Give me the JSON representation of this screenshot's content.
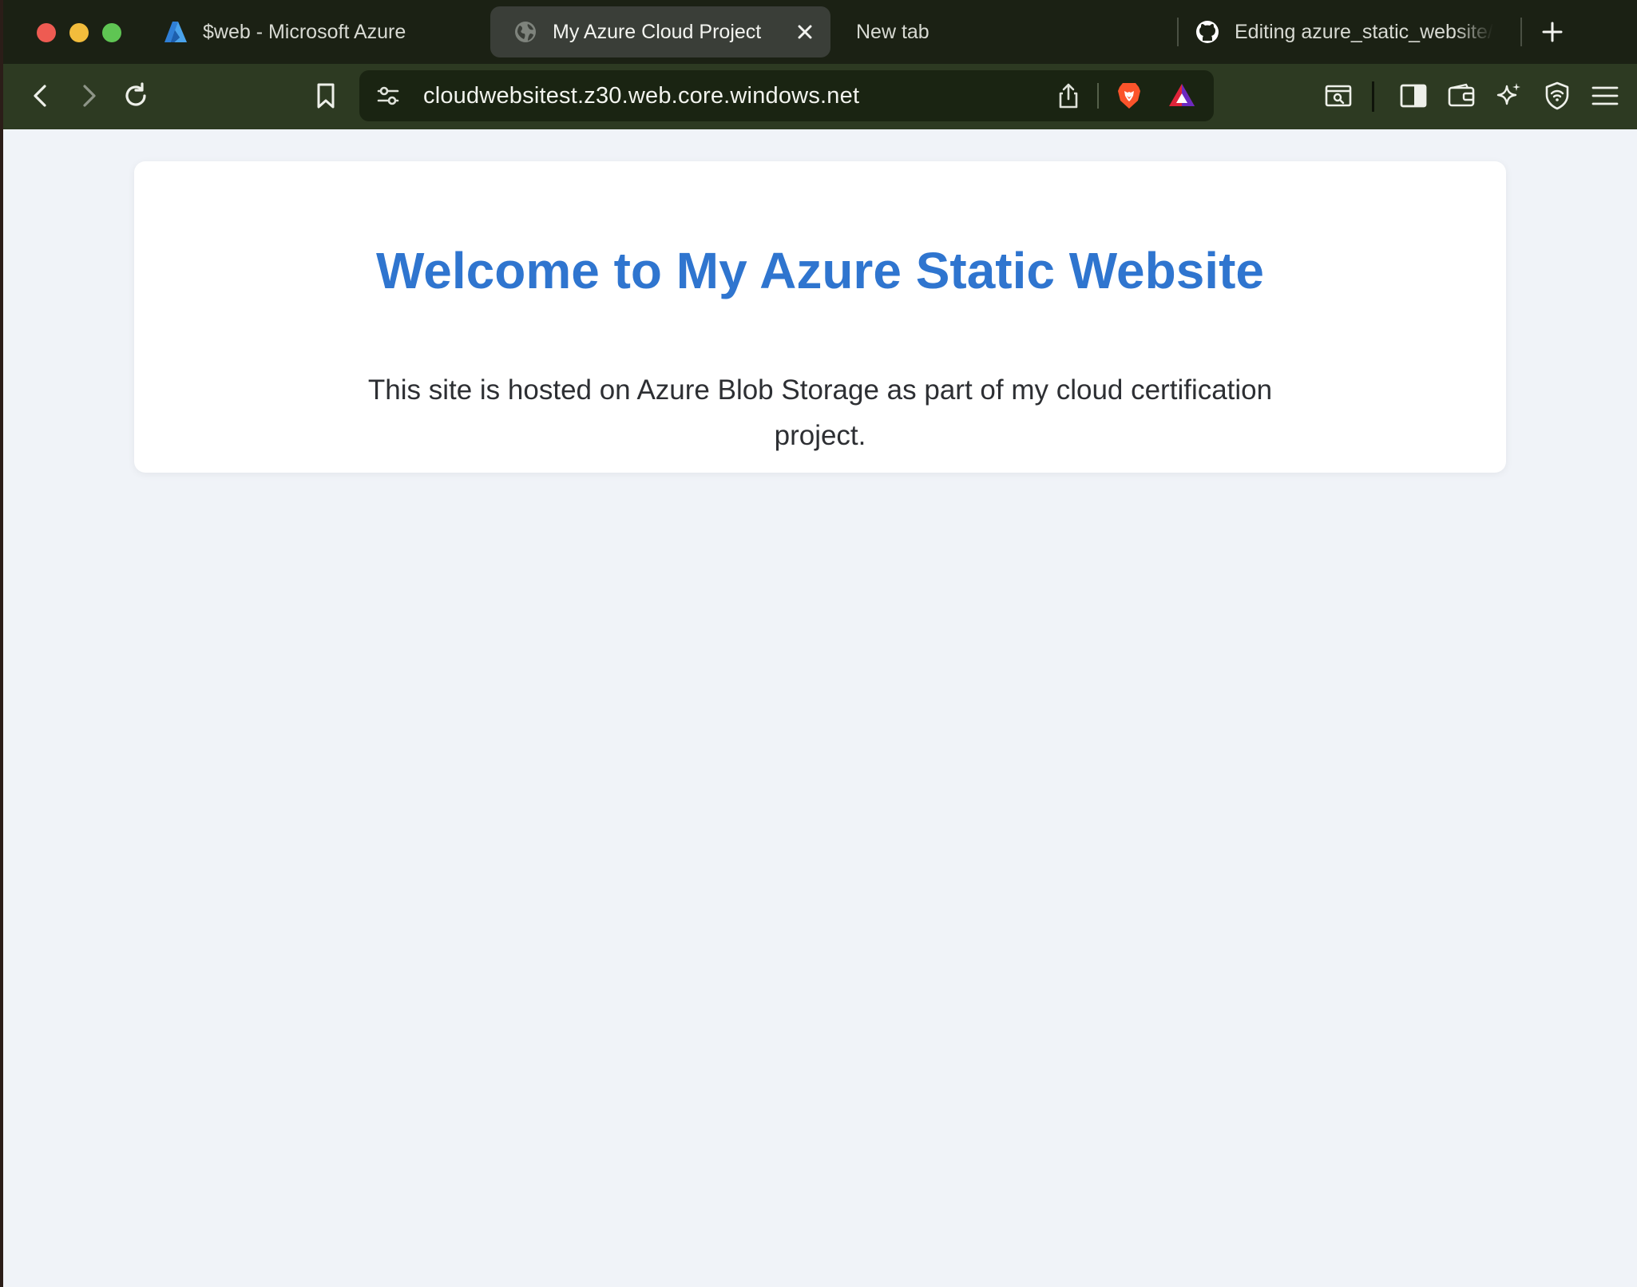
{
  "browser": {
    "tabs": [
      {
        "label": "$web - Microsoft Azure",
        "icon": "azure-logo-icon"
      },
      {
        "label": "My Azure Cloud Project",
        "icon": "globe-icon",
        "active": true
      },
      {
        "label": "New tab"
      },
      {
        "label": "Editing azure_static_website/",
        "icon": "github-icon"
      }
    ],
    "address_bar": {
      "url": "cloudwebsitest.z30.web.core.windows.net"
    },
    "colors": {
      "tabstrip_bg": "#1b2114",
      "toolbar_bg": "#2d3a22",
      "active_tab_bg": "#3a3e38"
    }
  },
  "page": {
    "heading": "Welcome to My Azure Static Website",
    "body_text": "This site is hosted on Azure Blob Storage as part of my cloud certification project.",
    "colors": {
      "heading": "#2f75cf",
      "background": "#f0f3f8",
      "card": "#ffffff"
    }
  }
}
